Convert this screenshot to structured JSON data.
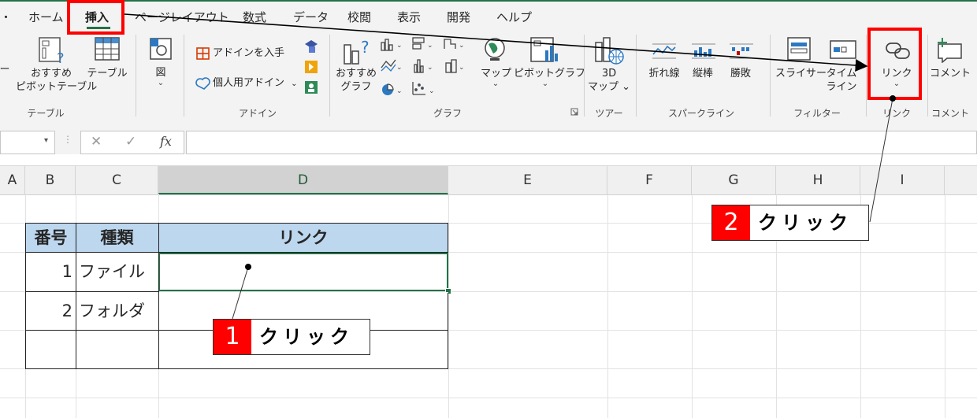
{
  "ribbon_tabs": [
    "ホーム",
    "挿入",
    "ページレイアウト",
    "数式",
    "データ",
    "校閲",
    "表示",
    "開発",
    "ヘルプ"
  ],
  "ribbon_tab_partial": "ト",
  "groups": {
    "table": {
      "label": "テーブル",
      "pivot_partial": "ー",
      "recommended_pivot": [
        "おすすめ",
        "ピボットテーブル"
      ],
      "table_button": "テーブル"
    },
    "illustrations": {
      "figure": "図"
    },
    "addins": {
      "label": "アドイン",
      "get_addins": "アドインを入手",
      "personal_addins": "個人用アドイン"
    },
    "charts": {
      "label": "グラフ",
      "recommended_charts": [
        "おすすめ",
        "グラフ"
      ],
      "maps": "マップ",
      "pivot_chart": "ピボットグラフ"
    },
    "tours": {
      "label": "ツアー",
      "map3d": [
        "3D",
        "マップ"
      ]
    },
    "sparklines": {
      "label": "スパークライン",
      "line": "折れ線",
      "column": "縦棒",
      "winloss": "勝敗"
    },
    "filters": {
      "label": "フィルター",
      "slicer": "スライサー",
      "timeline": [
        "タイム",
        "ライン"
      ]
    },
    "links": {
      "label": "リンク",
      "link": "リンク"
    },
    "comments": {
      "label": "コメント",
      "comment": "コメント"
    }
  },
  "formula_bar": {
    "fx": "fx",
    "cancel": "✕",
    "enter": "✓",
    "value": ""
  },
  "columns": [
    "A",
    "B",
    "C",
    "D",
    "E",
    "F",
    "G",
    "H",
    "I"
  ],
  "selected_column": "D",
  "table": {
    "headers": [
      "番号",
      "種類",
      "リンク"
    ],
    "rows": [
      {
        "num": "1",
        "type": "ファイル",
        "link": ""
      },
      {
        "num": "2",
        "type": "フォルダ",
        "link": ""
      },
      {
        "num": "",
        "type": "",
        "link": ""
      }
    ]
  },
  "callouts": [
    {
      "number": "1",
      "text": "クリック"
    },
    {
      "number": "2",
      "text": "クリック"
    }
  ],
  "colors": {
    "accent": "#217346",
    "highlight": "#ff0000",
    "header_fill": "#bdd7ee"
  }
}
